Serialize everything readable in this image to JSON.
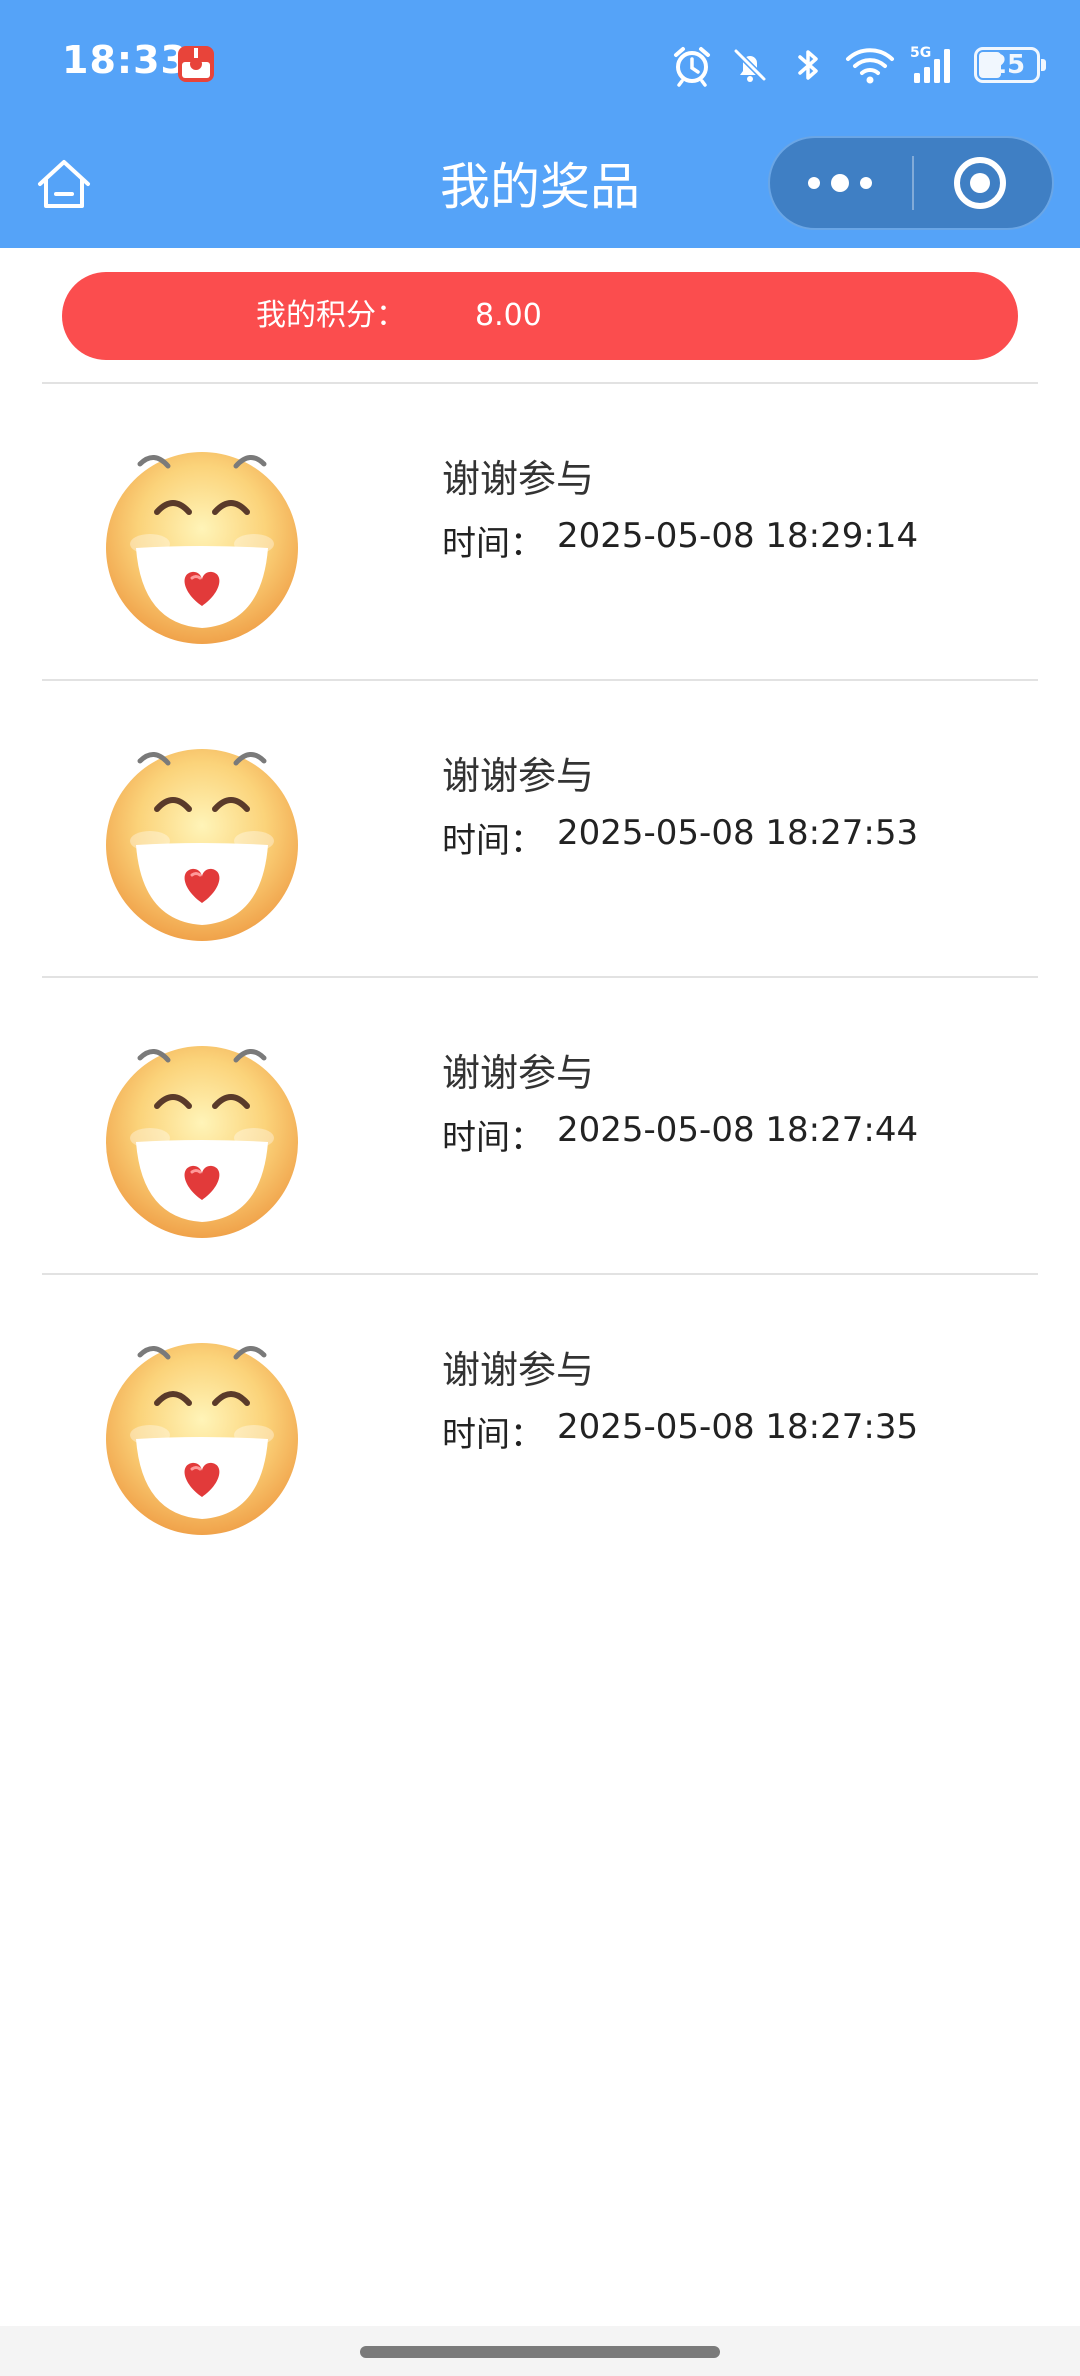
{
  "status_bar": {
    "time": "18:33",
    "app_icon": "red-app-icon",
    "icons": [
      "alarm-icon",
      "bell-muted-icon",
      "bluetooth-icon",
      "wifi-icon",
      "signal-5g-icon"
    ],
    "network_label": "5G",
    "battery_level": "25"
  },
  "nav": {
    "title": "我的奖品",
    "home_icon": "home-icon",
    "more_icon": "more-dots-icon",
    "close_icon": "target-circle-icon"
  },
  "points": {
    "label": "我的积分：",
    "value": "8.00"
  },
  "prizes": [
    {
      "name": "谢谢参与",
      "time_label": "时间：",
      "time": "2025-05-08 18:29:14"
    },
    {
      "name": "谢谢参与",
      "time_label": "时间：",
      "time": "2025-05-08 18:27:53"
    },
    {
      "name": "谢谢参与",
      "time_label": "时间：",
      "time": "2025-05-08 18:27:44"
    },
    {
      "name": "谢谢参与",
      "time_label": "时间：",
      "time": "2025-05-08 18:27:35"
    }
  ],
  "colors": {
    "nav_background": "#55a3f8",
    "points_background": "#fb4d4e",
    "divider": "#e2e2e2"
  }
}
